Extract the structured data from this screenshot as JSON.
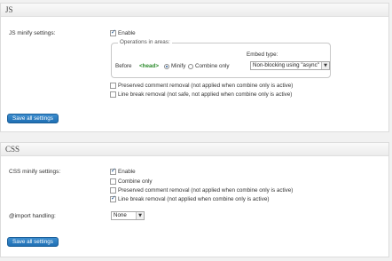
{
  "js": {
    "title": "JS",
    "minify_label": "JS minify settings:",
    "enable_label": "Enable",
    "ops_legend": "Operations in areas:",
    "before_label": "Before",
    "head_tag": "<head>",
    "minify_radio": "Minify",
    "combine_radio": "Combine only",
    "embed_label": "Embed type:",
    "embed_value": "Non-blocking using \"async\"",
    "preserve_comment": "Preserved comment removal (not applied when combine only is active)",
    "line_break": "Line break removal (not safe, not applied when combine only is active)",
    "save_label": "Save all settings"
  },
  "css": {
    "title": "CSS",
    "minify_label": "CSS minify settings:",
    "enable_label": "Enable",
    "combine_label": "Combine only",
    "preserve_comment": "Preserved comment removal (not applied when combine only is active)",
    "line_break": "Line break removal (not applied when combine only is active)",
    "import_label": "@import handling:",
    "import_value": "None",
    "save_label": "Save all settings"
  },
  "icons": {
    "select_arrow": "chevron-down-icon",
    "checkbox_check": "check-icon"
  }
}
